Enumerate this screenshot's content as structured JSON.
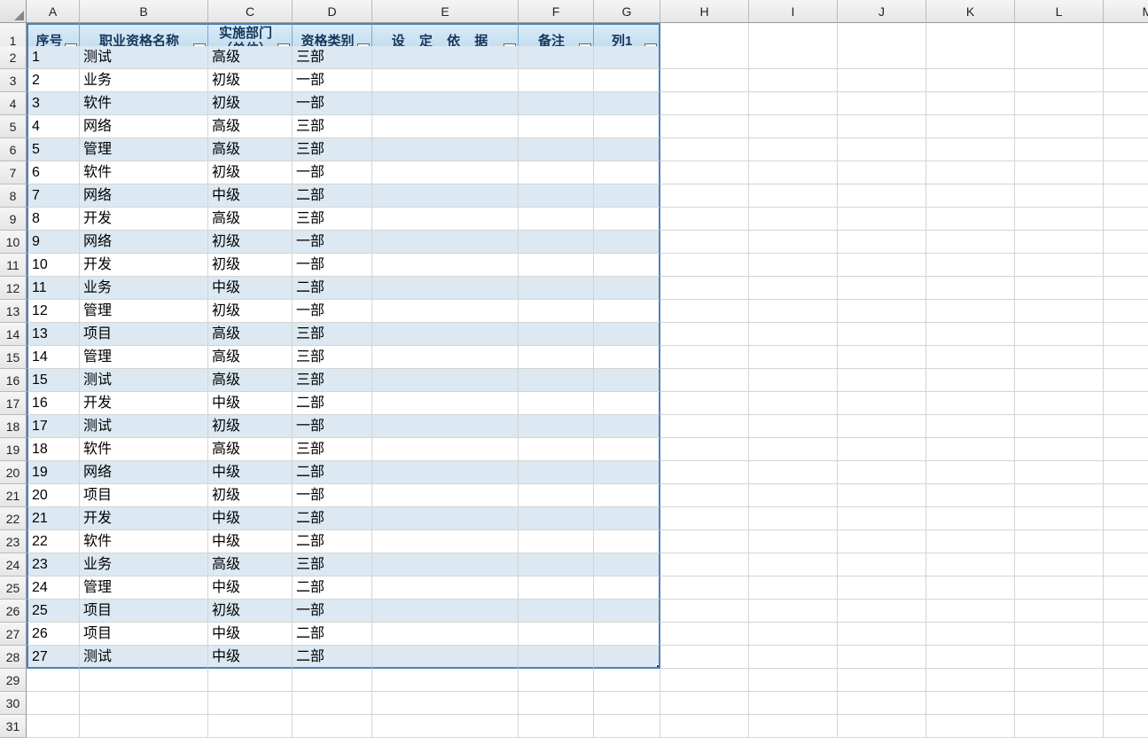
{
  "columns": [
    "A",
    "B",
    "C",
    "D",
    "E",
    "F",
    "G",
    "H",
    "I",
    "J",
    "K",
    "L",
    "M"
  ],
  "headerRowHeight": 40,
  "tableHeaders": [
    {
      "key": "A",
      "label": "序号",
      "sorted": false
    },
    {
      "key": "B",
      "label": "职业资格名称",
      "sorted": false
    },
    {
      "key": "C",
      "label": "实施部门（单位）",
      "sorted": false
    },
    {
      "key": "D",
      "label": "资格类别",
      "sorted": false
    },
    {
      "key": "E",
      "label": "设 定 依 据",
      "sorted": true
    },
    {
      "key": "F",
      "label": "备注",
      "sorted": false
    },
    {
      "key": "G",
      "label": "列1",
      "sorted": false
    }
  ],
  "rows": [
    {
      "n": "1",
      "name": "测试",
      "dept": "高级",
      "cat": "三部"
    },
    {
      "n": "2",
      "name": "业务",
      "dept": "初级",
      "cat": "一部"
    },
    {
      "n": "3",
      "name": "软件",
      "dept": "初级",
      "cat": "一部"
    },
    {
      "n": "4",
      "name": "网络",
      "dept": "高级",
      "cat": "三部"
    },
    {
      "n": "5",
      "name": "管理",
      "dept": "高级",
      "cat": "三部"
    },
    {
      "n": "6",
      "name": "软件",
      "dept": "初级",
      "cat": "一部"
    },
    {
      "n": "7",
      "name": "网络",
      "dept": "中级",
      "cat": "二部"
    },
    {
      "n": "8",
      "name": "开发",
      "dept": "高级",
      "cat": "三部"
    },
    {
      "n": "9",
      "name": "网络",
      "dept": "初级",
      "cat": "一部"
    },
    {
      "n": "10",
      "name": "开发",
      "dept": "初级",
      "cat": "一部"
    },
    {
      "n": "11",
      "name": "业务",
      "dept": "中级",
      "cat": "二部"
    },
    {
      "n": "12",
      "name": "管理",
      "dept": "初级",
      "cat": "一部"
    },
    {
      "n": "13",
      "name": "项目",
      "dept": "高级",
      "cat": "三部"
    },
    {
      "n": "14",
      "name": "管理",
      "dept": "高级",
      "cat": "三部"
    },
    {
      "n": "15",
      "name": "测试",
      "dept": "高级",
      "cat": "三部"
    },
    {
      "n": "16",
      "name": "开发",
      "dept": "中级",
      "cat": "二部"
    },
    {
      "n": "17",
      "name": "测试",
      "dept": "初级",
      "cat": "一部"
    },
    {
      "n": "18",
      "name": "软件",
      "dept": "高级",
      "cat": "三部"
    },
    {
      "n": "19",
      "name": "网络",
      "dept": "中级",
      "cat": "二部"
    },
    {
      "n": "20",
      "name": "项目",
      "dept": "初级",
      "cat": "一部"
    },
    {
      "n": "21",
      "name": "开发",
      "dept": "中级",
      "cat": "二部"
    },
    {
      "n": "22",
      "name": "软件",
      "dept": "中级",
      "cat": "二部"
    },
    {
      "n": "23",
      "name": "业务",
      "dept": "高级",
      "cat": "三部"
    },
    {
      "n": "24",
      "name": "管理",
      "dept": "中级",
      "cat": "二部"
    },
    {
      "n": "25",
      "name": "项目",
      "dept": "初级",
      "cat": "一部"
    },
    {
      "n": "26",
      "name": "项目",
      "dept": "中级",
      "cat": "二部"
    },
    {
      "n": "27",
      "name": "测试",
      "dept": "中级",
      "cat": "二部"
    }
  ],
  "emptyRowCount": 3,
  "rowNumberStart": 1,
  "totalVisibleRows": 30
}
